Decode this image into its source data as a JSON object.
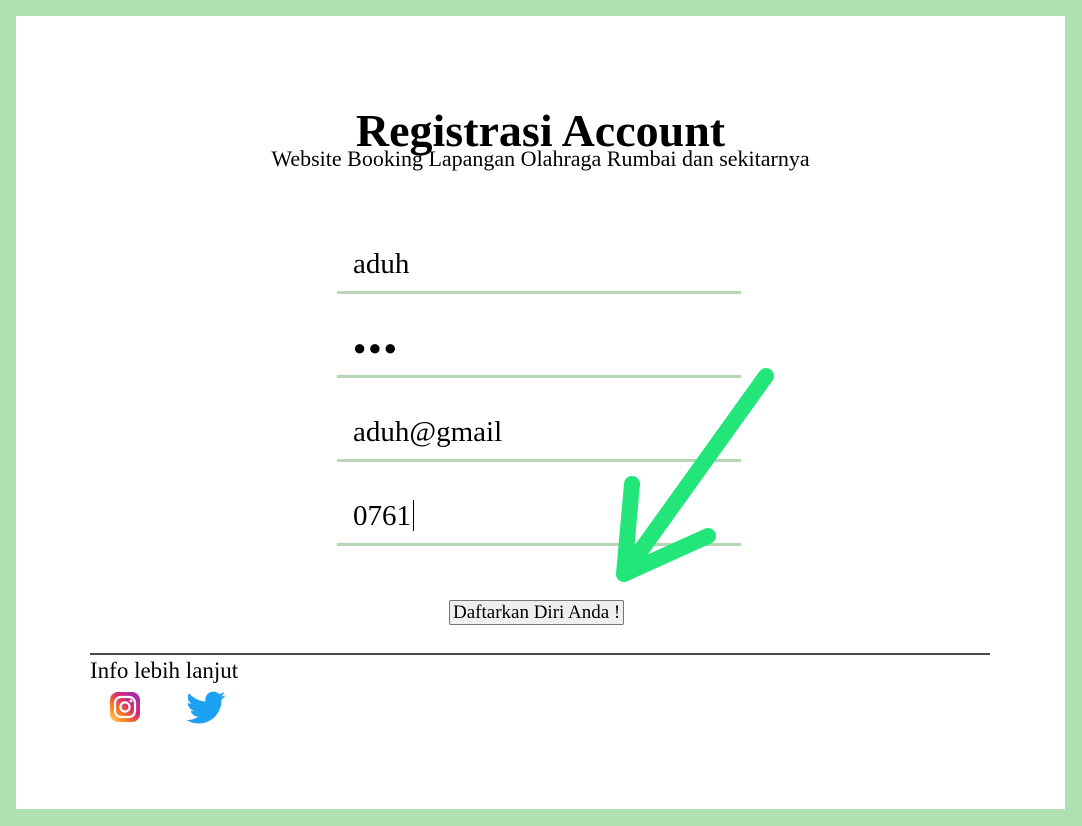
{
  "header": {
    "title": "Registrasi Account",
    "subtitle": "Website Booking Lapangan Olahraga Rumbai dan sekitarnya"
  },
  "form": {
    "username_value": "aduh",
    "password_mask": "●●●",
    "email_value": "aduh@gmail",
    "phone_value": "0761",
    "submit_label": "Daftarkan Diri Anda !"
  },
  "footer": {
    "info_label": "Info lebih lanjut",
    "social_icons": [
      "instagram-icon",
      "twitter-icon"
    ]
  },
  "colors": {
    "frame_background": "#ade1b1",
    "field_underline": "#b7d6b4",
    "annotation_arrow": "#22e67a",
    "twitter_blue": "#1da1f2"
  },
  "annotation": {
    "icon": "arrow-pointing-to-submit-button"
  }
}
